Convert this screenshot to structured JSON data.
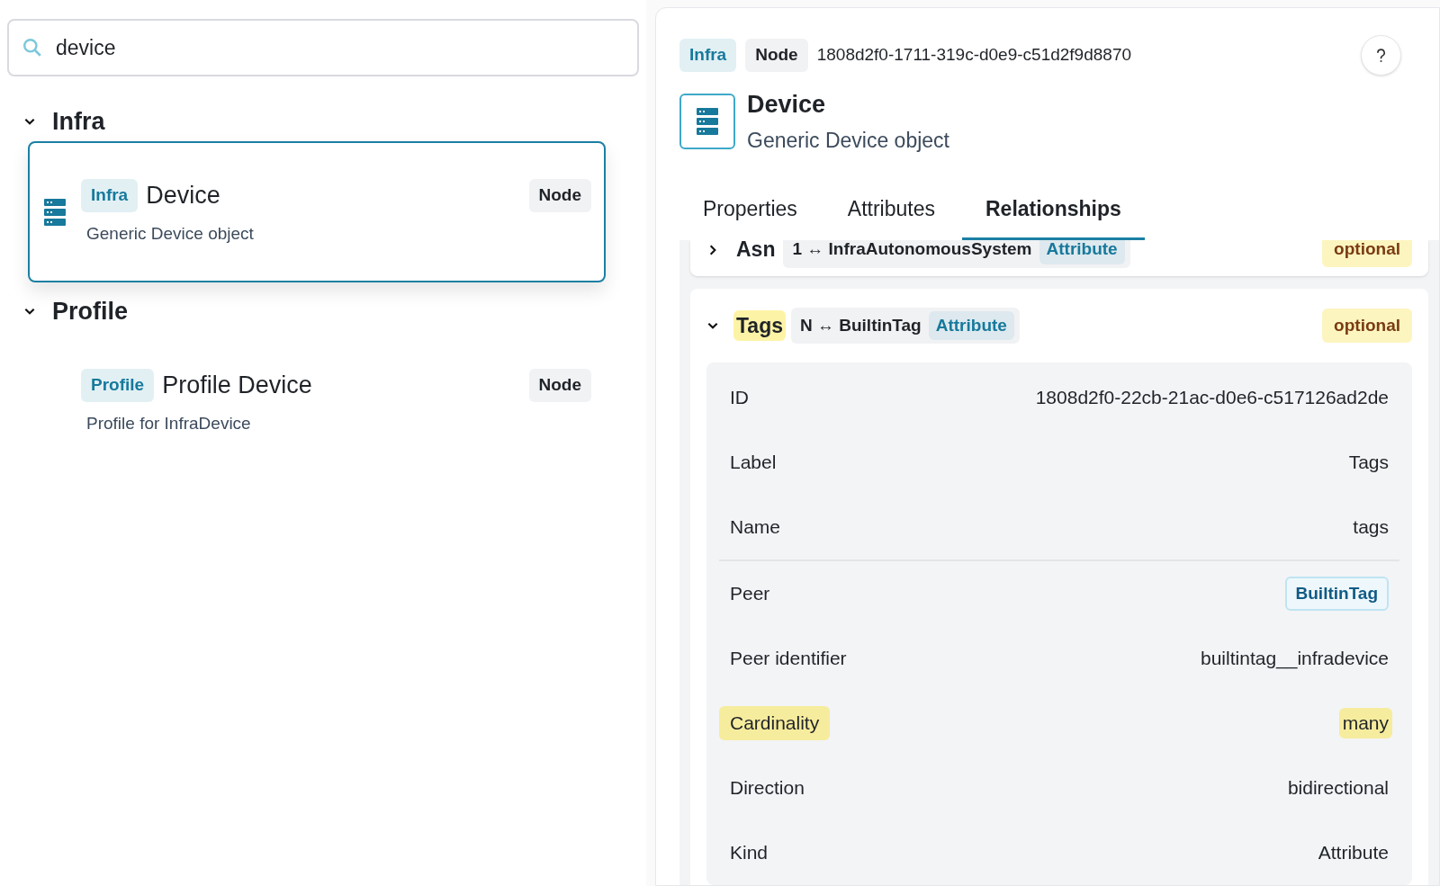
{
  "search": {
    "value": "device"
  },
  "groups": [
    {
      "label": "Infra",
      "expanded": true,
      "items": [
        {
          "namespace": "Infra",
          "name": "Device",
          "description": "Generic Device object",
          "type": "Node",
          "selected": true
        }
      ]
    },
    {
      "label": "Profile",
      "expanded": true,
      "items": [
        {
          "namespace": "Profile",
          "name": "Profile Device",
          "description": "Profile for InfraDevice",
          "type": "Node",
          "selected": false
        }
      ]
    }
  ],
  "detail": {
    "namespace": "Infra",
    "type": "Node",
    "id": "1808d2f0-1711-319c-d0e9-c51d2f9d8870",
    "title": "Device",
    "description": "Generic Device object",
    "tabs": [
      {
        "label": "Properties",
        "selected": false
      },
      {
        "label": "Attributes",
        "selected": false
      },
      {
        "label": "Relationships",
        "selected": true
      }
    ],
    "relationships": [
      {
        "name": "Asn",
        "expanded": false,
        "highlighted": false,
        "peer": "1 ↔ InfraAutonomousSystem",
        "kind": "Attribute",
        "optional": "optional"
      },
      {
        "name": "Tags",
        "expanded": true,
        "highlighted": true,
        "peer": "N ↔ BuiltinTag",
        "kind": "Attribute",
        "optional": "optional",
        "attribute_rows": [
          {
            "key": "ID",
            "value": "1808d2f0-22cb-21ac-d0e6-c517126ad2de",
            "kind": "text",
            "key_highlighted": false,
            "value_highlighted": false
          },
          {
            "key": "Label",
            "value": "Tags",
            "kind": "text",
            "key_highlighted": false,
            "value_highlighted": false
          },
          {
            "key": "Name",
            "value": "tags",
            "kind": "text",
            "key_highlighted": false,
            "value_highlighted": false
          }
        ],
        "relationship_rows": [
          {
            "key": "Peer",
            "value": "BuiltinTag",
            "kind": "badge",
            "key_highlighted": false,
            "value_highlighted": false
          },
          {
            "key": "Peer identifier",
            "value": "builtintag__infradevice",
            "kind": "text",
            "key_highlighted": false,
            "value_highlighted": false
          },
          {
            "key": "Cardinality",
            "value": "many",
            "kind": "text",
            "key_highlighted": true,
            "value_highlighted": true
          },
          {
            "key": "Direction",
            "value": "bidirectional",
            "kind": "text",
            "key_highlighted": false,
            "value_highlighted": false
          },
          {
            "key": "Kind",
            "value": "Attribute",
            "kind": "text",
            "key_highlighted": false,
            "value_highlighted": false
          }
        ]
      }
    ]
  }
}
